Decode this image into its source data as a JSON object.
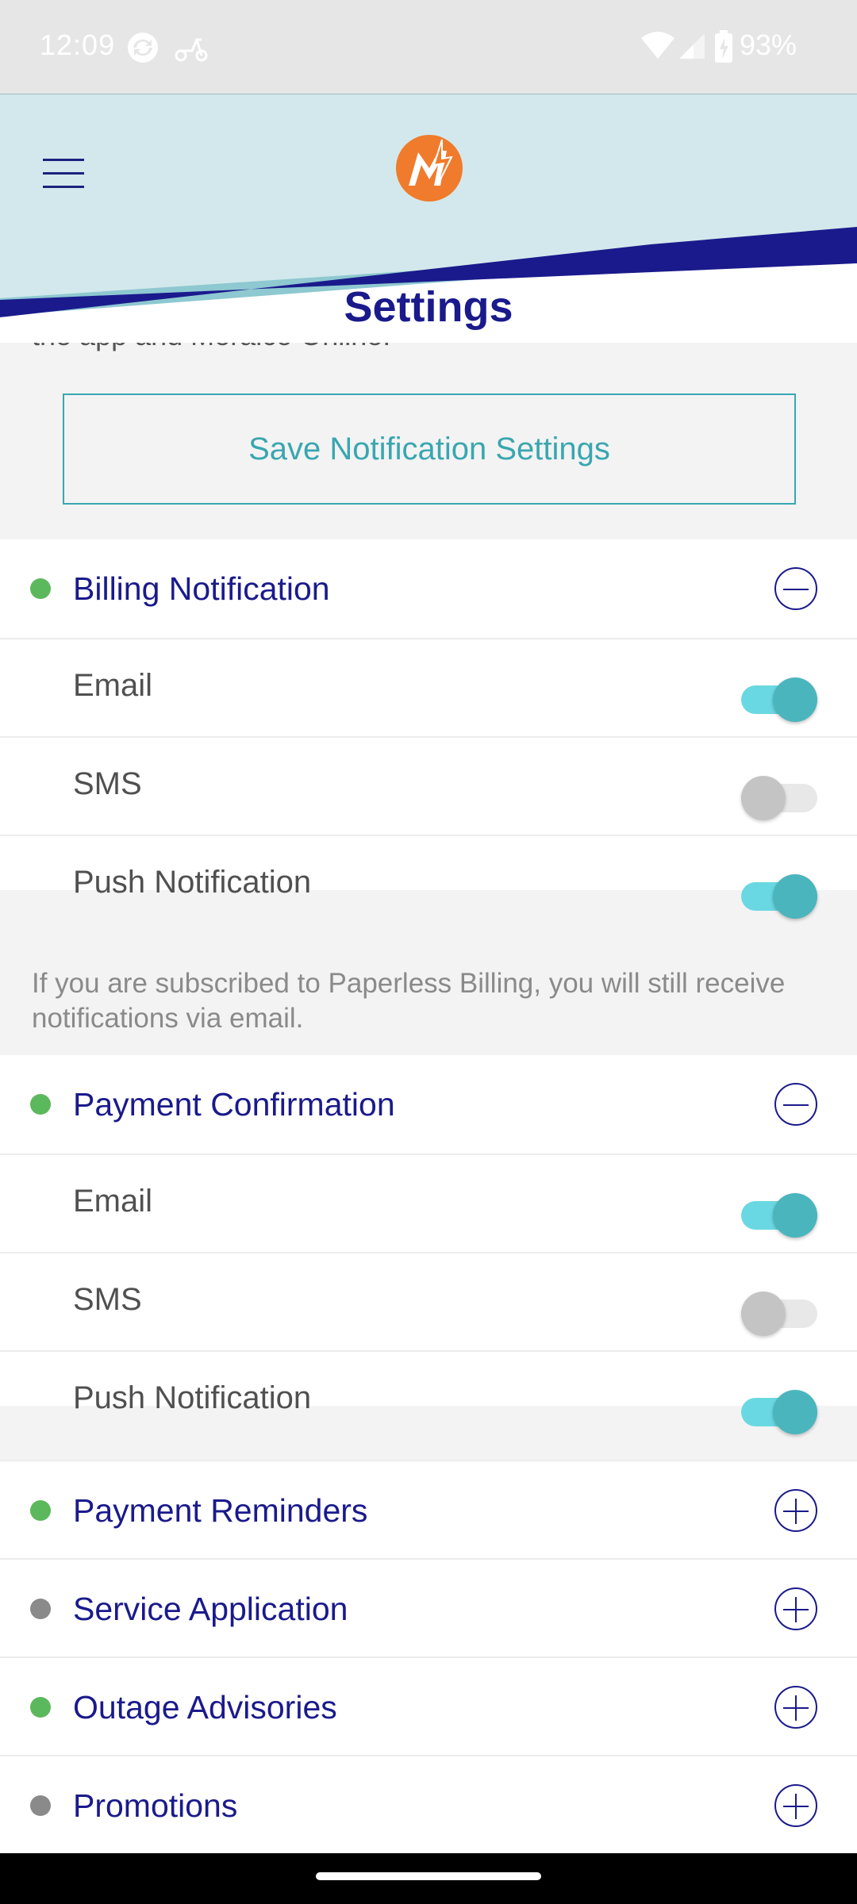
{
  "status_bar": {
    "time": "12:09",
    "battery": "93%",
    "icons": [
      "sync-icon",
      "scooter-icon",
      "wifi-icon",
      "signal-icon",
      "battery-icon"
    ]
  },
  "header": {
    "title": "Settings",
    "menu_icon": "hamburger-icon",
    "logo_icon": "meralco-logo",
    "colors": {
      "band_light": "#d3e8ec",
      "band_teal": "#8ec8d0",
      "band_navy": "#1a1a8c"
    }
  },
  "content": {
    "cut_text": "the app and Meralco Online.",
    "save_button": "Save Notification Settings",
    "billing": {
      "title": "Billing Notification",
      "status": "green",
      "expanded": true,
      "options": [
        {
          "label": "Email",
          "enabled": true
        },
        {
          "label": "SMS",
          "enabled": false
        },
        {
          "label": "Push Notification",
          "enabled": true
        }
      ],
      "info": "If you are subscribed to Paperless Billing, you will still receive notifications via email."
    },
    "payment_confirmation": {
      "title": "Payment Confirmation",
      "status": "green",
      "expanded": true,
      "options": [
        {
          "label": "Email",
          "enabled": true
        },
        {
          "label": "SMS",
          "enabled": false
        },
        {
          "label": "Push Notification",
          "enabled": true
        }
      ]
    },
    "collapsed_sections": [
      {
        "title": "Payment Reminders",
        "status": "green"
      },
      {
        "title": "Service Application",
        "status": "gray"
      },
      {
        "title": "Outage Advisories",
        "status": "green"
      },
      {
        "title": "Promotions",
        "status": "gray"
      }
    ],
    "colors": {
      "accent_teal": "#3aa6b0",
      "title_navy": "#1a1a8c",
      "dot_green": "#5cb85c",
      "dot_gray": "#8a8a8a"
    }
  }
}
